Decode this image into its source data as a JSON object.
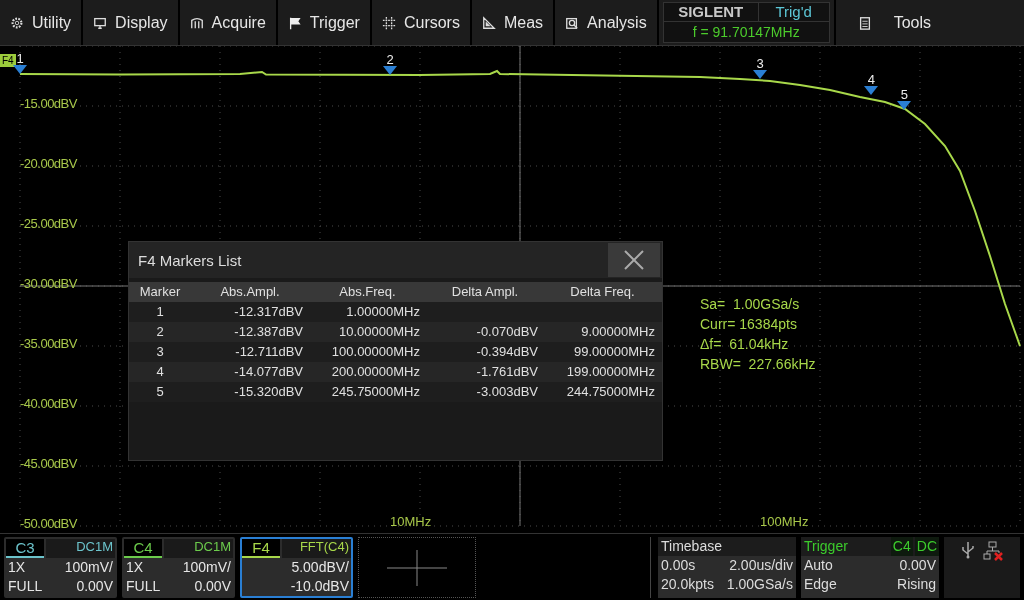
{
  "menu": [
    {
      "label": "Utility"
    },
    {
      "label": "Display"
    },
    {
      "label": "Acquire"
    },
    {
      "label": "Trigger"
    },
    {
      "label": "Cursors"
    },
    {
      "label": "Meas"
    },
    {
      "label": "Analysis"
    }
  ],
  "brand": {
    "logo": "SIGLENT",
    "status": "Trig'd",
    "frequency": "f = 91.70147MHz"
  },
  "tools": {
    "label": "Tools"
  },
  "plot": {
    "trace_tag": "F4",
    "y_labels": [
      "-15.00dBV",
      "-20.00dBV",
      "-25.00dBV",
      "-30.00dBV",
      "-35.00dBV",
      "-40.00dBV",
      "-45.00dBV",
      "-50.00dBV"
    ],
    "x_labels": [
      "10MHz",
      "100MHz"
    ],
    "markers": [
      {
        "label": "1"
      },
      {
        "label": "2"
      },
      {
        "label": "3"
      },
      {
        "label": "4"
      },
      {
        "label": "5"
      }
    ],
    "info": [
      "Sa=  1.00GSa/s",
      "Curr= 16384pts",
      "Δf=  61.04kHz",
      "RBW=  227.66kHz"
    ]
  },
  "markers_list": {
    "title": "F4 Markers List",
    "columns": [
      "Marker",
      "Abs.Ampl.",
      "Abs.Freq.",
      "Delta Ampl.",
      "Delta Freq."
    ],
    "rows": [
      {
        "marker": "1",
        "abs_ampl": "-12.317dBV",
        "abs_freq": "1.00000MHz"
      },
      {
        "marker": "2",
        "abs_ampl": "-12.387dBV",
        "abs_freq": "10.00000MHz",
        "delta_ampl": "-0.070dBV",
        "delta_freq": "9.00000MHz"
      },
      {
        "marker": "3",
        "abs_ampl": "-12.711dBV",
        "abs_freq": "100.00000MHz",
        "delta_ampl": "-0.394dBV",
        "delta_freq": "99.00000MHz"
      },
      {
        "marker": "4",
        "abs_ampl": "-14.077dBV",
        "abs_freq": "200.00000MHz",
        "delta_ampl": "-1.761dBV",
        "delta_freq": "199.00000MHz"
      },
      {
        "marker": "5",
        "abs_ampl": "-15.320dBV",
        "abs_freq": "245.75000MHz",
        "delta_ampl": "-3.003dBV",
        "delta_freq": "244.75000MHz"
      }
    ]
  },
  "channels": [
    {
      "name": "C3",
      "coupling": "DC1M",
      "probe": "1X",
      "scale": "100mV/",
      "range": "FULL",
      "offset": "0.00V",
      "selected": false,
      "color": "#6cc4cc"
    },
    {
      "name": "C4",
      "coupling": "DC1M",
      "probe": "1X",
      "scale": "100mV/",
      "range": "FULL",
      "offset": "0.00V",
      "selected": false,
      "color": "#6ccc4c"
    },
    {
      "name": "F4",
      "coupling": "FFT(C4)",
      "scale": "5.00dBV/",
      "offset": "-10.0dBV",
      "selected": true,
      "color": "#a8d84a"
    }
  ],
  "timebase": {
    "title": "Timebase",
    "delay": "0.00s",
    "scale": "2.00us/div",
    "points": "20.0kpts",
    "rate": "1.00GSa/s"
  },
  "trigger": {
    "title": "Trigger",
    "source": "C4",
    "coupling": "DC",
    "mode": "Auto",
    "level": "0.00V",
    "type": "Edge",
    "slope": "Rising"
  }
}
